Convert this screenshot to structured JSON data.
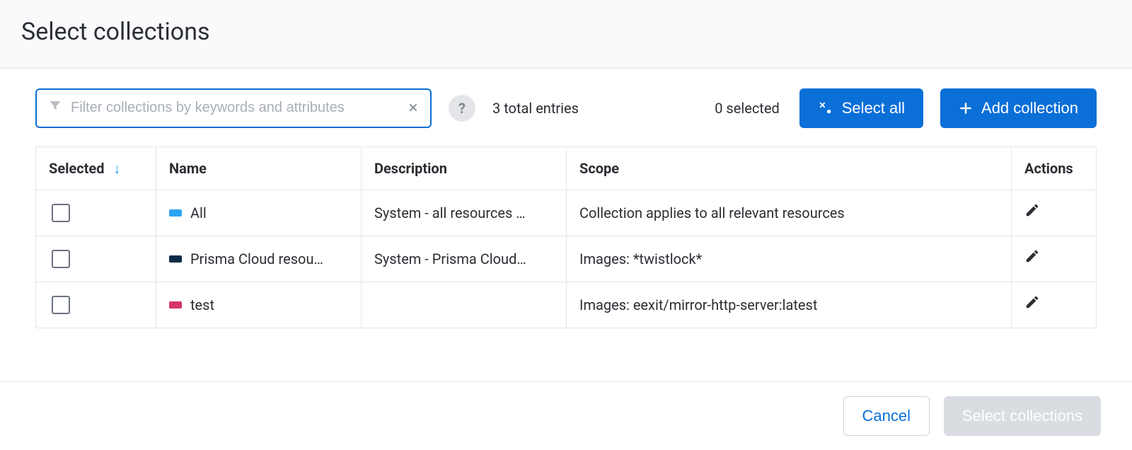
{
  "header": {
    "title": "Select collections"
  },
  "toolbar": {
    "filter_placeholder": "Filter collections by keywords and attributes",
    "total_entries": "3 total entries",
    "selected_count": "0 selected",
    "select_all_label": "Select all",
    "add_collection_label": "Add collection"
  },
  "table": {
    "headers": {
      "selected": "Selected",
      "name": "Name",
      "description": "Description",
      "scope": "Scope",
      "actions": "Actions"
    },
    "rows": [
      {
        "name": "All",
        "swatch": "#2ea3f2",
        "description": "System - all resources …",
        "scope": "Collection applies to all relevant resources"
      },
      {
        "name": "Prisma Cloud resou…",
        "swatch": "#0b2b4a",
        "description": "System - Prisma Cloud…",
        "scope": "Images: *twistlock*"
      },
      {
        "name": "test",
        "swatch": "#d6336c",
        "description": "",
        "scope": "Images: eexit/mirror-http-server:latest"
      }
    ]
  },
  "footer": {
    "cancel_label": "Cancel",
    "confirm_label": "Select collections"
  },
  "colors": {
    "primary": "#0b6fd8",
    "border": "#e4e6ea",
    "sort_arrow": "#2ea3f2"
  }
}
